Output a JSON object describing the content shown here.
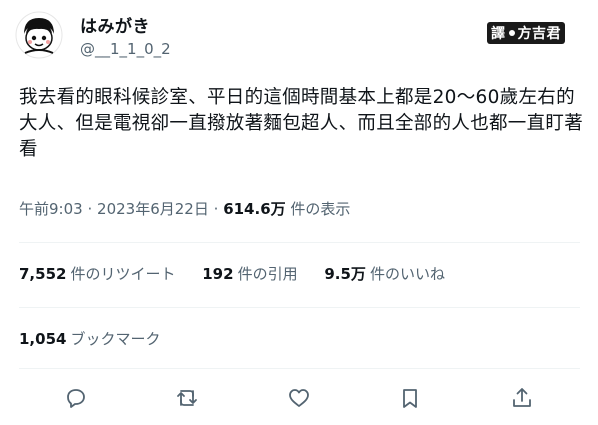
{
  "author": {
    "name": "はみがき",
    "handle": "@__1_1_0_2",
    "avatar_icon": "cartoon-girl-avatar-icon"
  },
  "stamp": {
    "label_left": "譯",
    "label_right": "方吉君"
  },
  "tweet": {
    "text": "我去看的眼科候診室、平日的這個時間基本上都是20～60歲左右的大人、但是電視卻一直撥放著麵包超人、而且全部的人也都一直盯著看"
  },
  "meta": {
    "time": "午前9:03",
    "sep": "·",
    "date": "2023年6月22日",
    "views_value": "614.6万",
    "views_label": "件の表示"
  },
  "stats": {
    "retweets_value": "7,552",
    "retweets_label": "件のリツイート",
    "quotes_value": "192",
    "quotes_label": "件の引用",
    "likes_value": "9.5万",
    "likes_label": "件のいいね"
  },
  "bookmarks": {
    "value": "1,054",
    "label": "ブックマーク"
  },
  "actions": [
    "reply-icon",
    "retweet-icon",
    "like-icon",
    "bookmark-icon",
    "share-icon"
  ],
  "colors": {
    "text": "#0f1419",
    "secondary": "#536471",
    "divider": "#eff3f4"
  }
}
